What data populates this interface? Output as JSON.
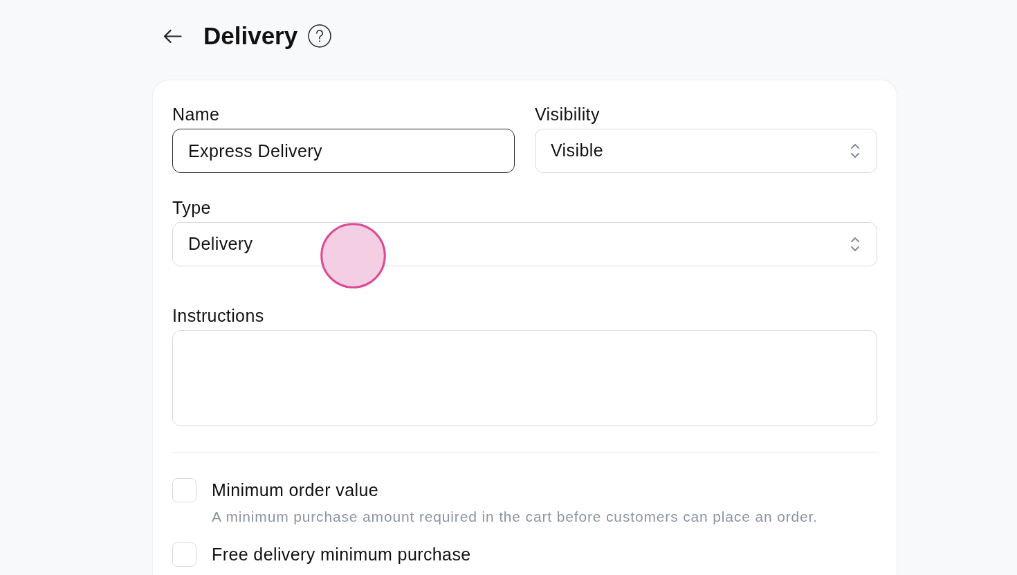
{
  "header": {
    "title": "Delivery"
  },
  "form": {
    "rows": [
      [
        {
          "kind": "text",
          "label": "Name",
          "value": "Express Delivery",
          "focused": true
        },
        {
          "kind": "select",
          "label": "Visibility",
          "value": "Visible",
          "focused": false
        }
      ],
      [
        {
          "kind": "select",
          "label": "Type",
          "value": "Delivery",
          "focused": false
        }
      ],
      [
        {
          "kind": "textarea",
          "label": "Instructions",
          "focused": false
        }
      ]
    ],
    "options": [
      {
        "label": "Minimum order value",
        "description": "A minimum purchase amount required in the cart before customers can place an order.",
        "checked": false
      },
      {
        "label": "Free delivery minimum purchase",
        "checked": false
      }
    ]
  }
}
